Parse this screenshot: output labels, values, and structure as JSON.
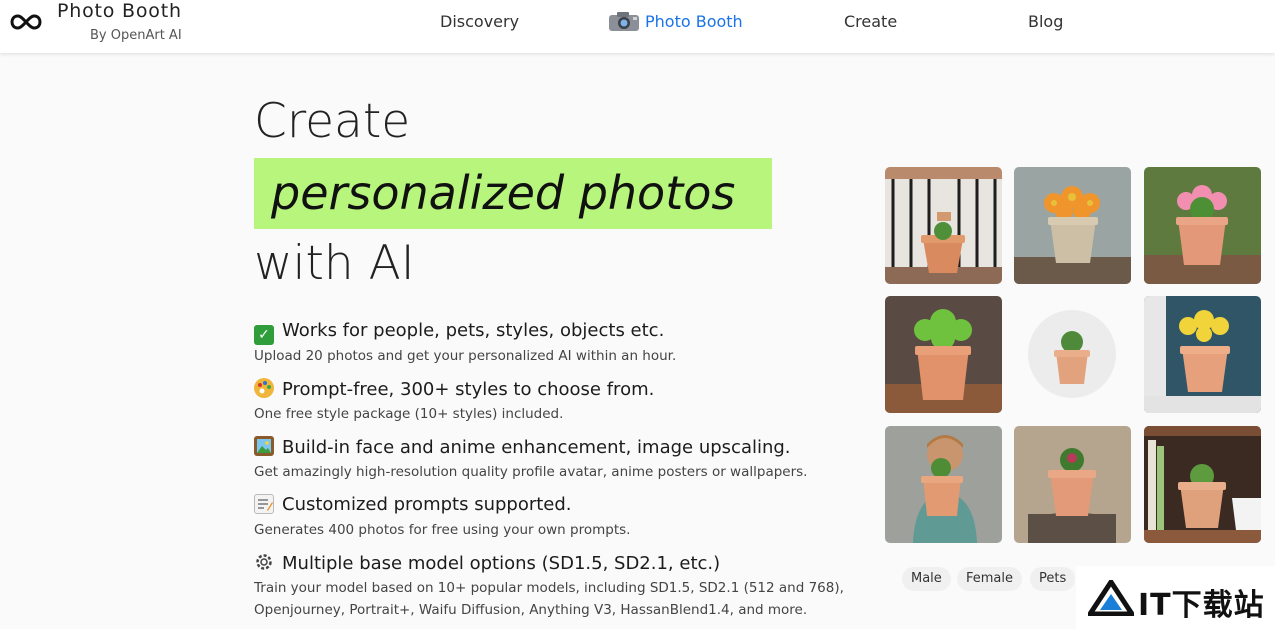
{
  "header": {
    "brand_title": "Photo Booth",
    "brand_subtitle": "By OpenArt AI",
    "nav": [
      {
        "label": "Discovery",
        "active": false
      },
      {
        "label": "Photo Booth",
        "active": true
      },
      {
        "label": "Create",
        "active": false
      },
      {
        "label": "Blog",
        "active": false
      }
    ],
    "accent_color": "#1a73e8"
  },
  "hero": {
    "line1": "Create",
    "highlight": "personalized photos",
    "line3": "with AI",
    "highlight_color": "#b7f57c"
  },
  "features": [
    {
      "icon": "check-mark-icon",
      "title": "Works for people, pets, styles, objects etc.",
      "desc": "Upload 20 photos and get your personalized AI within an hour."
    },
    {
      "icon": "palette-icon",
      "title": "Prompt-free, 300+ styles to choose from.",
      "desc": "One free style package (10+ styles) included."
    },
    {
      "icon": "framed-picture-icon",
      "title": "Build-in face and anime enhancement, image upscaling.",
      "desc": "Get amazingly high-resolution quality profile avatar, anime posters or wallpapers."
    },
    {
      "icon": "memo-icon",
      "title": "Customized prompts supported.",
      "desc": "Generates 400 photos for free using your own prompts."
    },
    {
      "icon": "gear-icon",
      "title": "Multiple base model options (SD1.5, SD2.1, etc.)",
      "desc": "Train your model based on 10+ popular models, including SD1.5, SD2.1 (512 and 768),",
      "desc2": "Openjourney, Portrait+, Waifu Diffusion, Anything V3, HassanBlend1.4, and more."
    }
  ],
  "gallery": {
    "tags": [
      "Male",
      "Female",
      "Pets"
    ]
  },
  "watermark": {
    "text": "IT下载站"
  }
}
